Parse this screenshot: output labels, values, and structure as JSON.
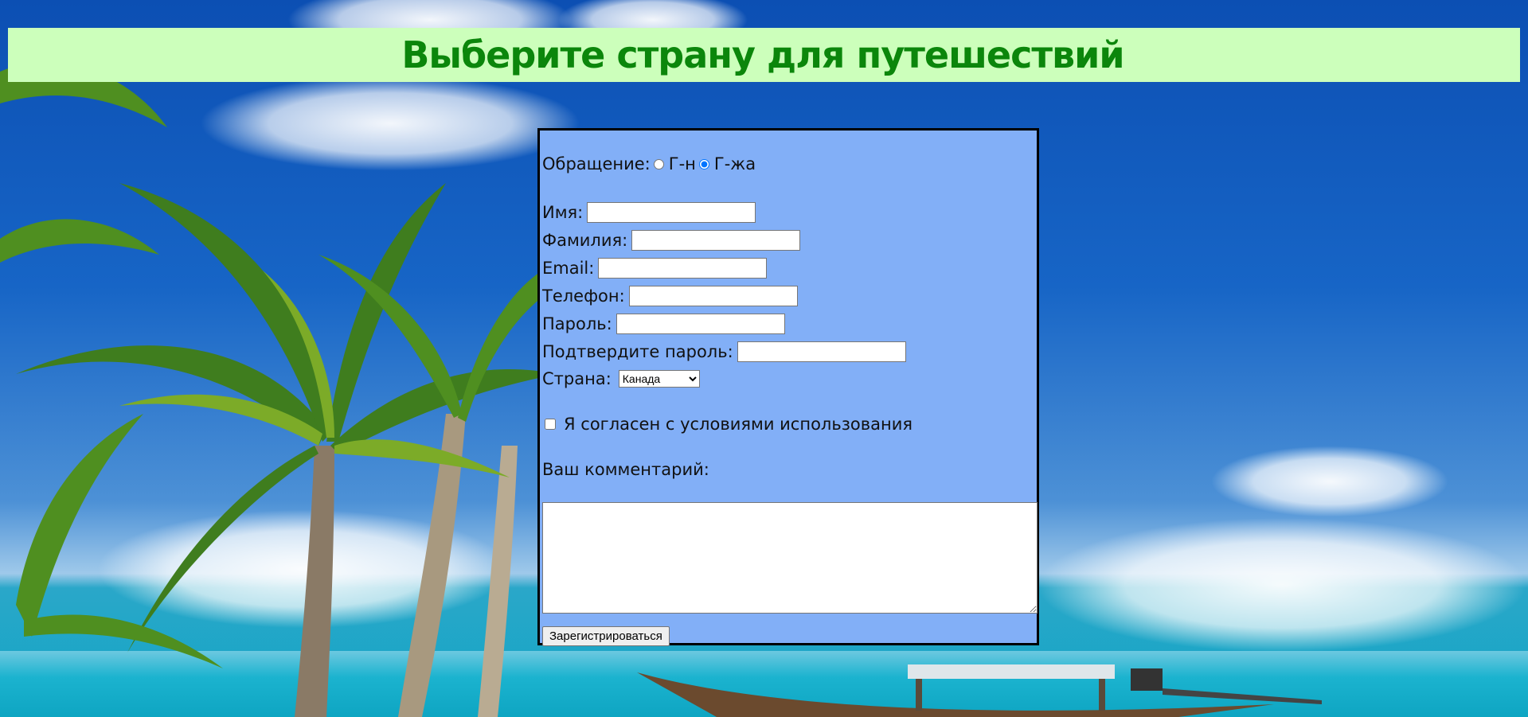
{
  "header": {
    "title": "Выберите страну для путешествий"
  },
  "form": {
    "salutation_label": "Обращение:",
    "salutation_options": [
      {
        "label": "Г-н",
        "checked": false
      },
      {
        "label": "Г-жа",
        "checked": true
      }
    ],
    "first_name_label": "Имя:",
    "first_name_value": "",
    "last_name_label": "Фамилия:",
    "last_name_value": "",
    "email_label": "Email:",
    "email_value": "",
    "phone_label": "Телефон:",
    "phone_value": "",
    "password_label": "Пароль:",
    "password_value": "",
    "confirm_password_label": "Подтвердите пароль:",
    "confirm_password_value": "",
    "country_label": "Страна:",
    "country_selected": "Канада",
    "terms_label": "Я согласен с условиями использования",
    "terms_checked": false,
    "comment_label": "Ваш комментарий:",
    "comment_value": "",
    "submit_label": "Зарегистрироваться"
  },
  "colors": {
    "header_bg": "#ccffbb",
    "header_text": "#0b860b",
    "form_bg": "#82aff7",
    "form_border": "#000000"
  }
}
